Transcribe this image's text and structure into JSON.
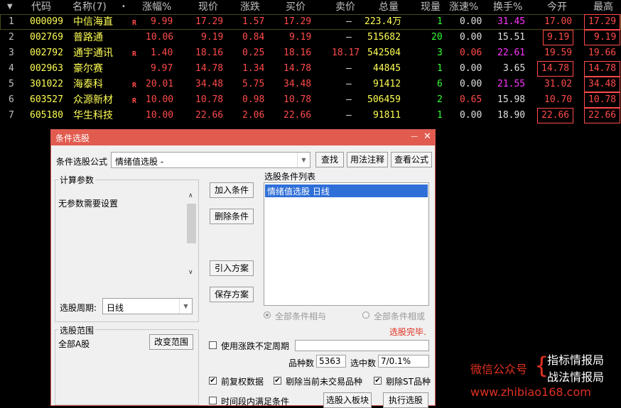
{
  "table": {
    "header": {
      "sort_arrow": "▼",
      "code": "代码",
      "name": "名称(7)",
      "dot": "•",
      "change_pct": "涨幅%",
      "price": "现价",
      "change": "涨跌",
      "bid": "买价",
      "ask": "卖价",
      "volume": "总量",
      "cur_vol": "现量",
      "speed": "涨速%",
      "turnover": "换手%",
      "open": "今开",
      "high": "最高"
    },
    "rows": [
      {
        "idx": "1",
        "code": "000099",
        "name": "中信海直",
        "flag": "R",
        "change_pct": "9.99",
        "price": "17.29",
        "change": "1.57",
        "bid": "17.29",
        "ask": "—",
        "volume": "223.4万",
        "cur_vol": "1",
        "speed": "0.00",
        "turnover": "31.45",
        "open": "17.00",
        "high": "17.29"
      },
      {
        "idx": "2",
        "code": "002769",
        "name": "普路通",
        "flag": "",
        "change_pct": "10.06",
        "price": "9.19",
        "change": "0.84",
        "bid": "9.19",
        "ask": "—",
        "volume": "515682",
        "cur_vol": "20",
        "speed": "0.00",
        "turnover": "15.51",
        "open": "9.19",
        "high": "9.19"
      },
      {
        "idx": "3",
        "code": "002792",
        "name": "通宇通讯",
        "flag": "R",
        "change_pct": "1.40",
        "price": "18.16",
        "change": "0.25",
        "bid": "18.16",
        "ask": "18.17",
        "volume": "542504",
        "cur_vol": "3",
        "speed": "0.06",
        "turnover": "22.61",
        "open": "19.59",
        "high": "19.66"
      },
      {
        "idx": "4",
        "code": "002963",
        "name": "豪尔赛",
        "flag": "",
        "change_pct": "9.97",
        "price": "14.78",
        "change": "1.34",
        "bid": "14.78",
        "ask": "—",
        "volume": "44845",
        "cur_vol": "1",
        "speed": "0.00",
        "turnover": "3.65",
        "open": "14.78",
        "high": "14.78"
      },
      {
        "idx": "5",
        "code": "301022",
        "name": "海泰科",
        "flag": "R",
        "change_pct": "20.01",
        "price": "34.48",
        "change": "5.75",
        "bid": "34.48",
        "ask": "—",
        "volume": "91412",
        "cur_vol": "6",
        "speed": "0.00",
        "turnover": "21.55",
        "open": "31.02",
        "high": "34.48"
      },
      {
        "idx": "6",
        "code": "603527",
        "name": "众源新材",
        "flag": "R",
        "change_pct": "10.00",
        "price": "10.78",
        "change": "0.98",
        "bid": "10.78",
        "ask": "—",
        "volume": "506459",
        "cur_vol": "2",
        "speed": "0.65",
        "turnover": "15.98",
        "open": "10.70",
        "high": "10.78"
      },
      {
        "idx": "7",
        "code": "605180",
        "name": "华生科技",
        "flag": "",
        "change_pct": "10.00",
        "price": "22.66",
        "change": "2.06",
        "bid": "22.66",
        "ask": "—",
        "volume": "91811",
        "cur_vol": "1",
        "speed": "0.00",
        "turnover": "18.90",
        "open": "22.66",
        "high": "22.66"
      }
    ]
  },
  "dialog": {
    "title": "条件选股",
    "minimize": "—",
    "close": "✕",
    "formula_label": "条件选股公式",
    "formula_value": "情绪值选股  -",
    "find_btn": "查找",
    "usage_btn": "用法注释",
    "view_btn": "查看公式",
    "params_title": "计算参数",
    "params_text": "无参数需要设置",
    "add_btn": "加入条件",
    "delete_btn": "删除条件",
    "import_btn": "引入方案",
    "save_btn": "保存方案",
    "list_title": "选股条件列表",
    "list_items": [
      "情绪值选股  日线"
    ],
    "period_label": "选股周期:",
    "period_value": "日线",
    "radio_and": "全部条件相与",
    "radio_or": "全部条件相或",
    "status": "选股完毕.",
    "range_title": "选股范围",
    "range_value": "全部A股",
    "change_range_btn": "改变范围",
    "use_period_label": "使用涨跌不定周期",
    "count_label": "品种数",
    "count_value": "5363",
    "selected_label": "选中数",
    "selected_value": "7/0.1%",
    "chk_fq": "前复权数据",
    "chk_exclude_untraded": "剔除当前未交易品种",
    "chk_exclude_st": "剔除ST品种",
    "chk_time": "时间段内满足条件",
    "to_block_btn": "选股入板块",
    "run_btn": "执行选股"
  },
  "watermark": {
    "wechat": "微信公众号",
    "brace": "{",
    "line1": "指标情报局",
    "line2": "战法情报局",
    "url": "www.zhibiao168.com"
  }
}
